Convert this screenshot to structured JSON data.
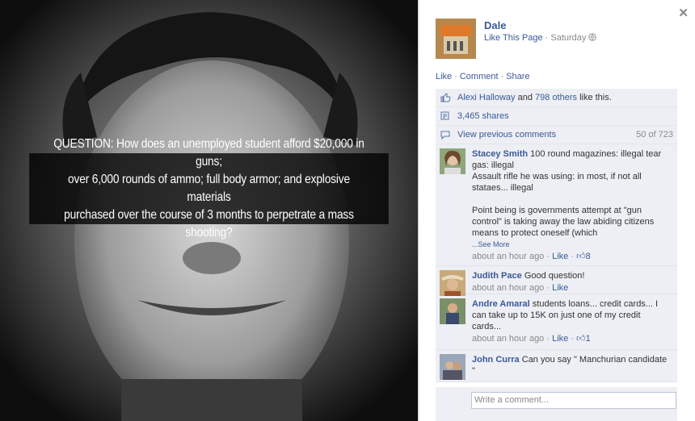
{
  "photo": {
    "caption_lines": [
      "QUESTION: How does an unemployed student afford $20,000 in guns;",
      "over 6,000 rounds of ammo; full body armor; and explosive materials",
      "purchased over the course of 3 months to perpetrate a mass shooting?"
    ]
  },
  "post": {
    "page_name": "Dale",
    "like_page": "Like This Page",
    "separator": "·",
    "timestamp": "Saturday",
    "actions": [
      "Like",
      "Comment",
      "Share"
    ]
  },
  "likes": {
    "name": "Alexi Halloway",
    "and": "and",
    "others": "798 others",
    "suffix": "like this."
  },
  "shares": "3,465 shares",
  "previous": {
    "label": "View previous comments",
    "count": "50 of 723"
  },
  "comments": [
    {
      "author": "Stacey Smith",
      "paragraphs": [
        "100 round magazines: illegal tear gas: illegal",
        "Assault rifle he was using: in most, if not all stataes... illegal"
      ],
      "paragraph2": "Point being is governments attempt at \"gun control\" is taking away the law abiding citizens means to protect oneself (which",
      "see_more": "...See More",
      "time": "about an hour ago",
      "like": "Like",
      "likes_count": "8"
    },
    {
      "author": "Judith Pace",
      "text": "Good question!",
      "time": "about an hour ago",
      "like": "Like"
    },
    {
      "author": "Andre Amaral",
      "text": "students loans... credit cards... I can take up to 15K on just one of my credit cards...",
      "time": "about an hour ago",
      "like": "Like",
      "likes_count": "1"
    },
    {
      "author": "John Curra",
      "text": "Can you say \" Manchurian candidate \""
    }
  ],
  "composer": {
    "placeholder": "Write a comment..."
  },
  "colors": {
    "link": "#3b5998",
    "panel_bg": "#edeff4",
    "muted": "#888888"
  },
  "icons": [
    "close-icon",
    "globe-icon",
    "thumbs-up-icon",
    "shares-icon"
  ]
}
